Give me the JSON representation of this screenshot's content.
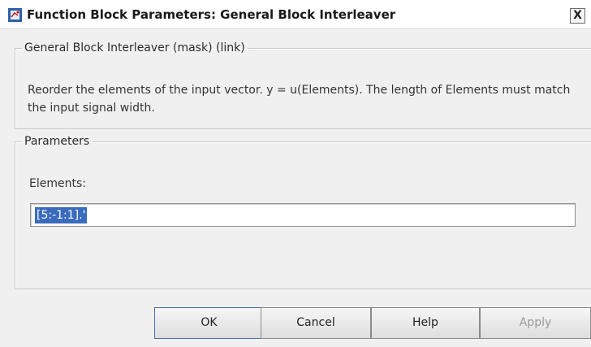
{
  "window": {
    "title": "Function Block Parameters: General Block Interleaver",
    "close_label": "X"
  },
  "description_group": {
    "legend": "General Block Interleaver (mask) (link)",
    "text": "Reorder the elements of the input vector. y = u(Elements). The length of Elements must match the input signal width."
  },
  "parameters_group": {
    "legend": "Parameters",
    "elements_label": "Elements:",
    "elements_value": "[5:-1:1].'"
  },
  "buttons": {
    "ok": "OK",
    "cancel": "Cancel",
    "help": "Help",
    "apply": "Apply"
  },
  "colors": {
    "selection": "#3a6bbd",
    "disabled_text": "#9b9b9b"
  }
}
